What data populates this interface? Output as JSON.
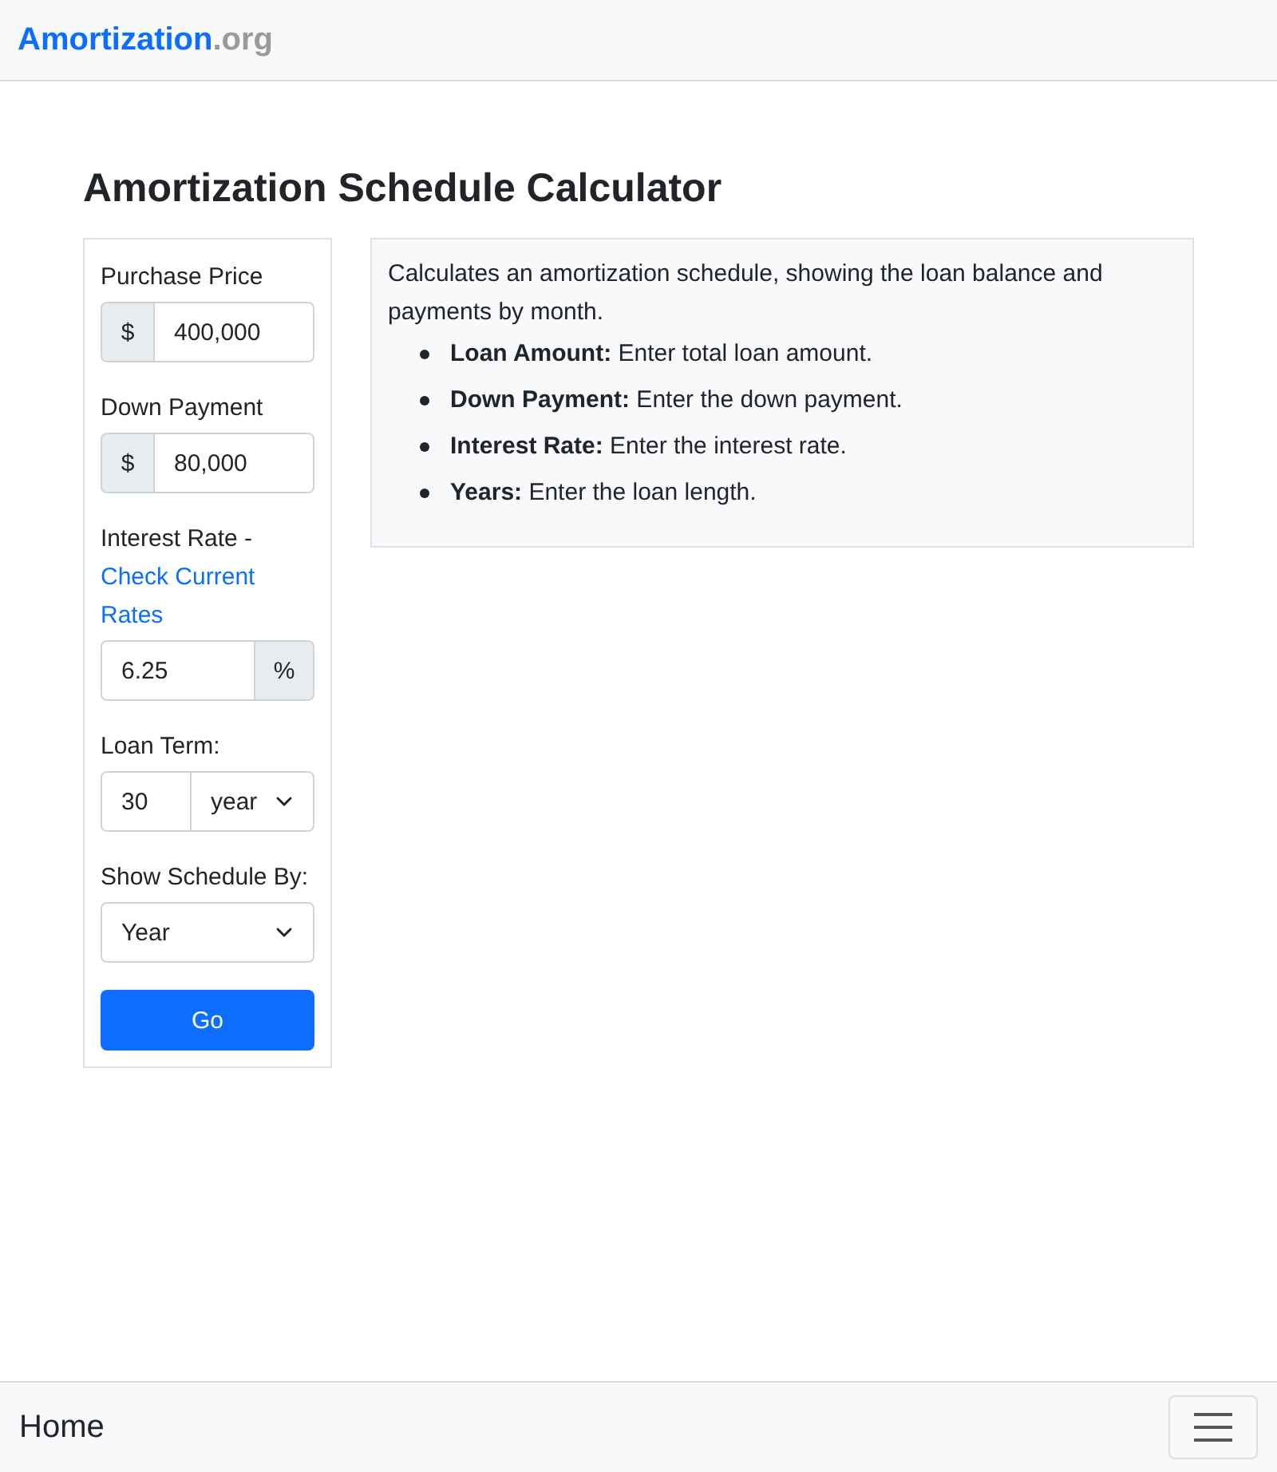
{
  "brand": {
    "name": "Amortization",
    "suffix": ".org"
  },
  "title": "Amortization Schedule Calculator",
  "form": {
    "fields": [
      {
        "kind": "prefix",
        "label": "Purchase Price",
        "addon": "$",
        "value": "400,000"
      },
      {
        "kind": "prefix",
        "label": "Down Payment",
        "addon": "$",
        "value": "80,000"
      },
      {
        "kind": "suffix",
        "label": "Interest Rate -",
        "link": "Check Current Rates",
        "addon": "%",
        "value": "6.25"
      },
      {
        "kind": "pair",
        "label": "Loan Term:",
        "value": "30",
        "select": "year"
      },
      {
        "kind": "select",
        "label": "Show Schedule By:",
        "select": "Year"
      }
    ],
    "button": "Go"
  },
  "info": {
    "intro": "Calculates an amortization schedule, showing the loan balance and payments by month.",
    "bullets": [
      "**Loan Amount:** Enter total loan amount.",
      "**Down Payment:** Enter the down payment.",
      "**Interest Rate:** Enter the interest rate.",
      "**Years:** Enter the loan length."
    ]
  },
  "footer": {
    "home": "Home"
  }
}
